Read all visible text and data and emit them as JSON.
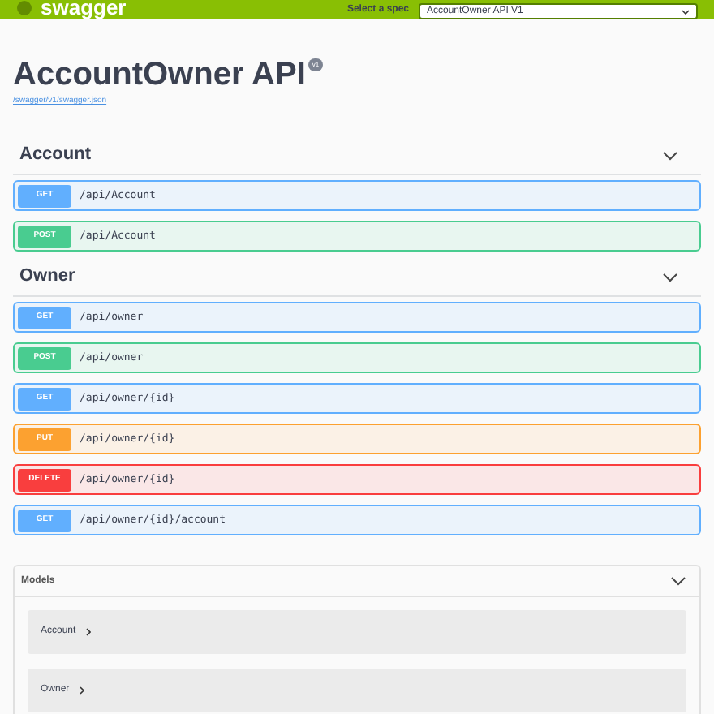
{
  "topbar": {
    "logo": "swagger",
    "spec_label": "Select a spec",
    "spec_value": "AccountOwner API V1"
  },
  "info": {
    "title": "AccountOwner API",
    "version": "v1",
    "link": "/swagger/v1/swagger.json"
  },
  "sections": [
    {
      "name": "Account",
      "expanded": true,
      "operations": [
        {
          "kind": "get",
          "method": "GET",
          "path": "/api/Account"
        },
        {
          "kind": "post",
          "method": "POST",
          "path": "/api/Account"
        }
      ]
    },
    {
      "name": "Owner",
      "expanded": true,
      "operations": [
        {
          "kind": "get",
          "method": "GET",
          "path": "/api/owner"
        },
        {
          "kind": "post",
          "method": "POST",
          "path": "/api/owner"
        },
        {
          "kind": "get",
          "method": "GET",
          "path": "/api/owner/{id}"
        },
        {
          "kind": "put",
          "method": "PUT",
          "path": "/api/owner/{id}"
        },
        {
          "kind": "delete",
          "method": "DELETE",
          "path": "/api/owner/{id}"
        },
        {
          "kind": "get",
          "method": "GET",
          "path": "/api/owner/{id}/account"
        }
      ]
    }
  ],
  "models": {
    "title": "Models",
    "expanded": true,
    "items": [
      {
        "name": "Account"
      },
      {
        "name": "Owner"
      }
    ]
  }
}
